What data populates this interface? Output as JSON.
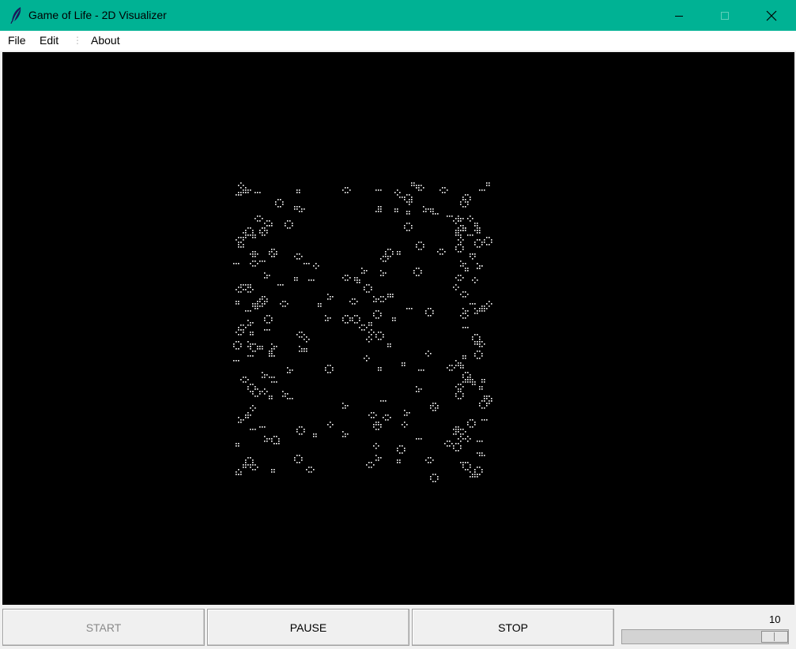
{
  "window": {
    "title": "Game of Life - 2D Visualizer",
    "accent_color": "#00b294",
    "icon": "feather-icon"
  },
  "menu": {
    "items": [
      {
        "label": "File"
      },
      {
        "label": "Edit"
      },
      {
        "label": "⋮"
      },
      {
        "label": "About"
      }
    ]
  },
  "canvas": {
    "background": "#000000",
    "cell_color": "#ffffff",
    "grid_cols": 160,
    "grid_rows": 140,
    "seed": 7
  },
  "controls": {
    "start_label": "START",
    "start_enabled": false,
    "pause_label": "PAUSE",
    "stop_label": "STOP",
    "speed": {
      "value": "10",
      "fraction": 1.0
    }
  }
}
